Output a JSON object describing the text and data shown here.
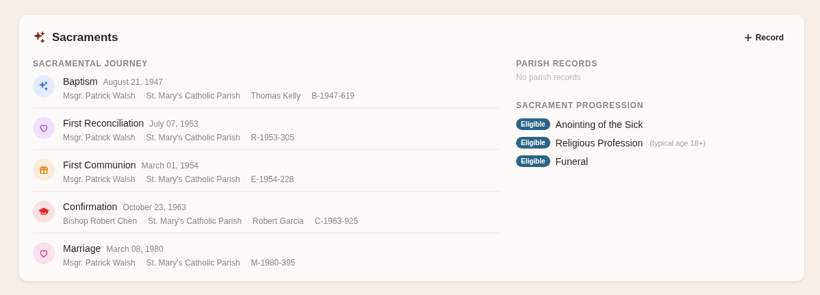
{
  "card": {
    "title": "Sacraments",
    "action": "Record"
  },
  "journey": {
    "heading": "SACRAMENTAL JOURNEY",
    "items": [
      {
        "name": "Baptism",
        "date": "August 21, 1947",
        "kind": "sparkle",
        "color": "#3b6fe0",
        "details": [
          "Msgr. Patrick Walsh",
          "St. Mary's Catholic Parish",
          "Thomas Kelly",
          "B-1947-619"
        ]
      },
      {
        "name": "First Reconciliation",
        "date": "July 07, 1953",
        "kind": "heart",
        "color": "#9333ea",
        "details": [
          "Msgr. Patrick Walsh",
          "St. Mary's Catholic Parish",
          "R-1953-305"
        ]
      },
      {
        "name": "First Communion",
        "date": "March 01, 1954",
        "kind": "gift",
        "color": "#d97706",
        "details": [
          "Msgr. Patrick Walsh",
          "St. Mary's Catholic Parish",
          "E-1954-228"
        ]
      },
      {
        "name": "Confirmation",
        "date": "October 23, 1963",
        "kind": "cap",
        "color": "#dc2626",
        "details": [
          "Bishop Robert Chen",
          "St. Mary's Catholic Parish",
          "Robert Garcia",
          "C-1963-925"
        ]
      },
      {
        "name": "Marriage",
        "date": "March 08, 1980",
        "kind": "heart",
        "color": "#db2777",
        "details": [
          "Msgr. Patrick Walsh",
          "St. Mary's Catholic Parish",
          "M-1980-395"
        ]
      }
    ]
  },
  "parish_records": {
    "heading": "PARISH RECORDS",
    "empty_text": "No parish records"
  },
  "progression": {
    "heading": "SACRAMENT PROGRESSION",
    "items": [
      {
        "status": "Eligible",
        "name": "Anointing of the Sick"
      },
      {
        "status": "Eligible",
        "name": "Religious Profession",
        "note": "(typical age 18+)"
      },
      {
        "status": "Eligible",
        "name": "Funeral"
      }
    ]
  }
}
